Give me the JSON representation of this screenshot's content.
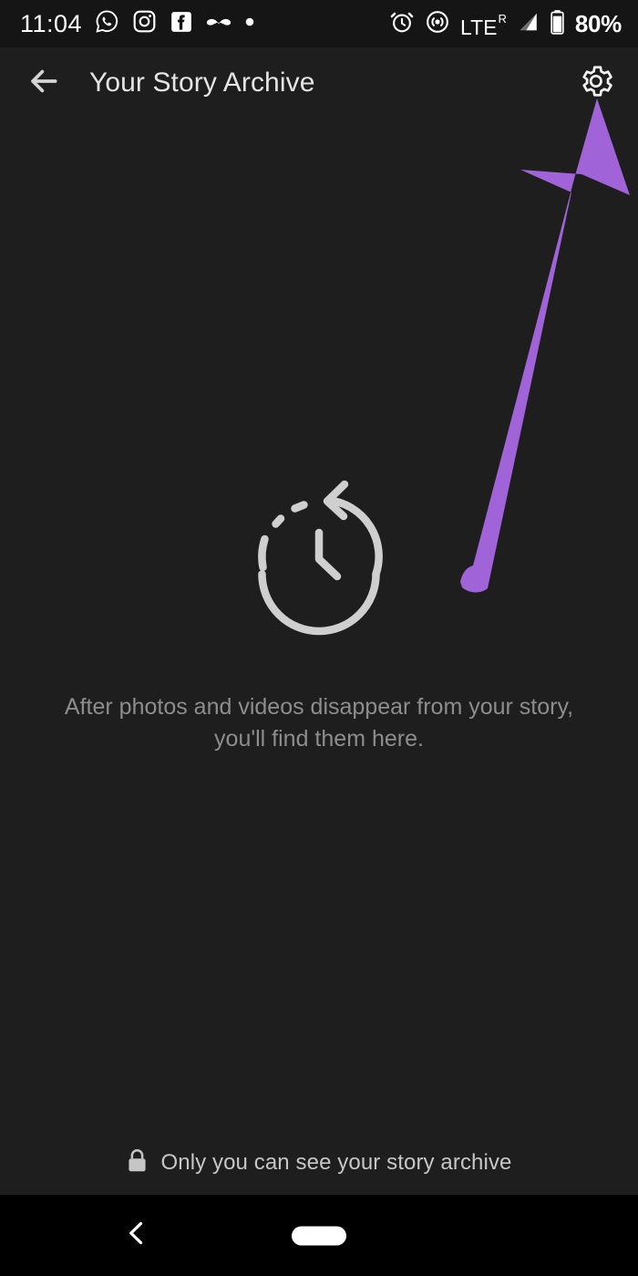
{
  "status_bar": {
    "time": "11:04",
    "battery_percent": "80%",
    "network_label": "LTE",
    "network_roaming": "R",
    "left_icons": [
      "whatsapp-icon",
      "instagram-icon",
      "facebook-icon",
      "mustache-app-icon",
      "dot-indicator-icon"
    ],
    "right_icons": [
      "alarm-clock-icon",
      "hotspot-icon",
      "signal-bars-icon",
      "battery-icon"
    ]
  },
  "app_bar": {
    "title": "Your Story Archive",
    "back_icon": "arrow-left-icon",
    "settings_icon": "gear-icon"
  },
  "empty_state": {
    "illustration": "archive-clock-icon",
    "message": "After photos and videos disappear from your story, you'll find them here."
  },
  "privacy_footer": {
    "lock_icon": "lock-icon",
    "text": "Only you can see your story archive"
  },
  "nav_bar": {
    "back_icon": "chevron-left-icon",
    "home_pill": "home-pill-indicator"
  },
  "annotation": {
    "type": "arrow",
    "color": "#a163d8",
    "points_to": "gear-icon"
  },
  "colors": {
    "background": "#1e1e1e",
    "status_bar_background": "#151515",
    "nav_bar_background": "#000000",
    "title_text": "#e4e4e4",
    "body_text": "#8d8d8d",
    "footer_text": "#c6c6c6",
    "icon_light": "#d4d4d4",
    "annotation_purple": "#a163d8"
  }
}
